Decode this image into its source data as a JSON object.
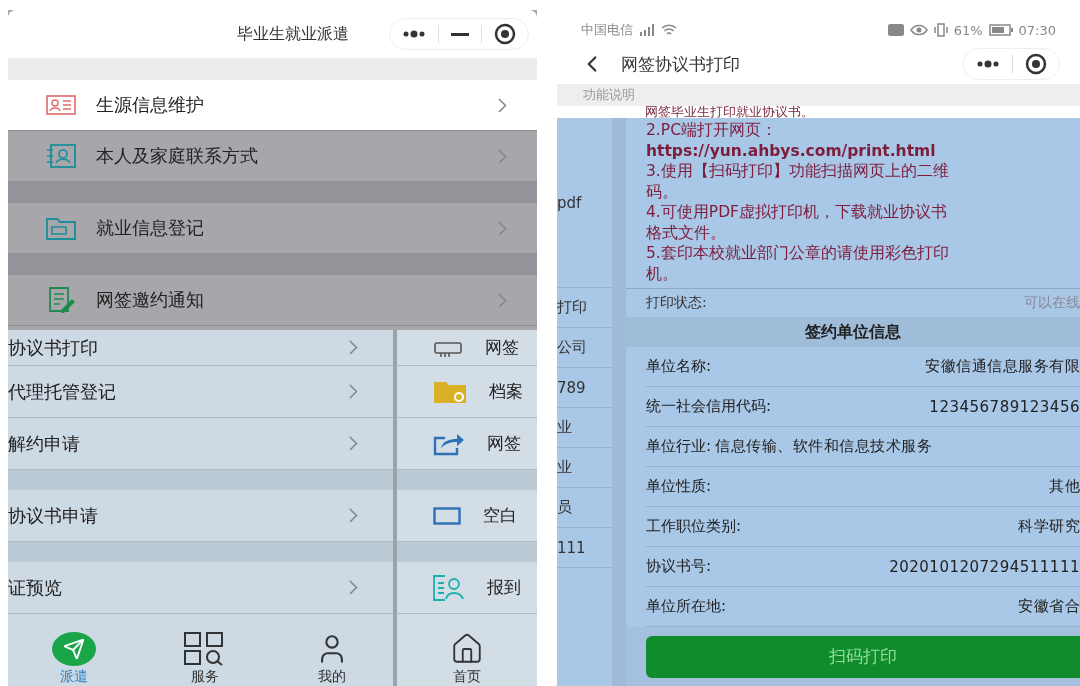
{
  "left_screen": {
    "title": "毕业生就业派遣",
    "top_groups": [
      [
        {
          "label": "生源信息维护",
          "dimmed": false
        },
        {
          "label": "本人及家庭联系方式",
          "dimmed": true
        }
      ],
      [
        {
          "label": "就业信息登记",
          "dimmed": true
        }
      ],
      [
        {
          "label": "网签邀约通知",
          "dimmed": true
        }
      ]
    ],
    "list_groups": [
      [
        "协议书打印",
        "代理托管登记",
        "解约申请"
      ],
      [
        "协议书申请"
      ],
      [
        "证预览"
      ]
    ],
    "side_groups": [
      [
        "网签",
        "档案",
        "网签"
      ],
      [
        "空白"
      ],
      [
        "报到"
      ]
    ],
    "tabs": [
      {
        "label": "派遣",
        "selected": true
      },
      {
        "label": "服务",
        "selected": false
      },
      {
        "label": "我的",
        "selected": false
      }
    ],
    "side_tab": {
      "label": "首页",
      "selected": false
    }
  },
  "right_screen": {
    "status_bar": {
      "carrier": "中国电信",
      "battery": "61%",
      "time": "07:30"
    },
    "title": "网签协议书打印",
    "section": "功能说明",
    "first_line": "网签毕业生打印就业协议书。",
    "instructions": [
      {
        "kind": "text",
        "text": "2.PC端打开网页："
      },
      {
        "kind": "link",
        "text": "https://yun.ahbys.com/print.html"
      },
      {
        "kind": "text",
        "text": "3.使用【扫码打印】功能扫描网页上的二维"
      },
      {
        "kind": "text",
        "text": "码。"
      },
      {
        "kind": "text",
        "text": "4.可使用PDF虚拟打印机，下载就业协议书"
      },
      {
        "kind": "text",
        "text": "格式文件。"
      },
      {
        "kind": "text",
        "text": "5.套印本校就业部门公章的请使用彩色打印"
      },
      {
        "kind": "text",
        "text": "机。"
      }
    ],
    "side_fragments": [
      "pdf",
      "打印",
      "公司",
      "789",
      "业",
      "业",
      "员",
      "111"
    ],
    "print_status": {
      "label": "打印状态:",
      "value": "可以在线"
    },
    "info_title": "签约单位信息",
    "fields": [
      {
        "kind": "split",
        "label": "单位名称:",
        "value": "安徽信通信息服务有限"
      },
      {
        "kind": "split",
        "label": "统一社会信用代码:",
        "value": "123456789123456"
      },
      {
        "kind": "inline",
        "label": "单位行业:",
        "value": "信息传输、软件和信息技术服务"
      },
      {
        "kind": "split",
        "label": "单位性质:",
        "value": "其他"
      },
      {
        "kind": "split",
        "label": "工作职位类别:",
        "value": "科学研究"
      },
      {
        "kind": "split",
        "label": "协议书号:",
        "value": "2020101207294511111"
      },
      {
        "kind": "split",
        "label": "单位所在地:",
        "value": "安徽省合"
      }
    ],
    "button": "扫码打印"
  }
}
